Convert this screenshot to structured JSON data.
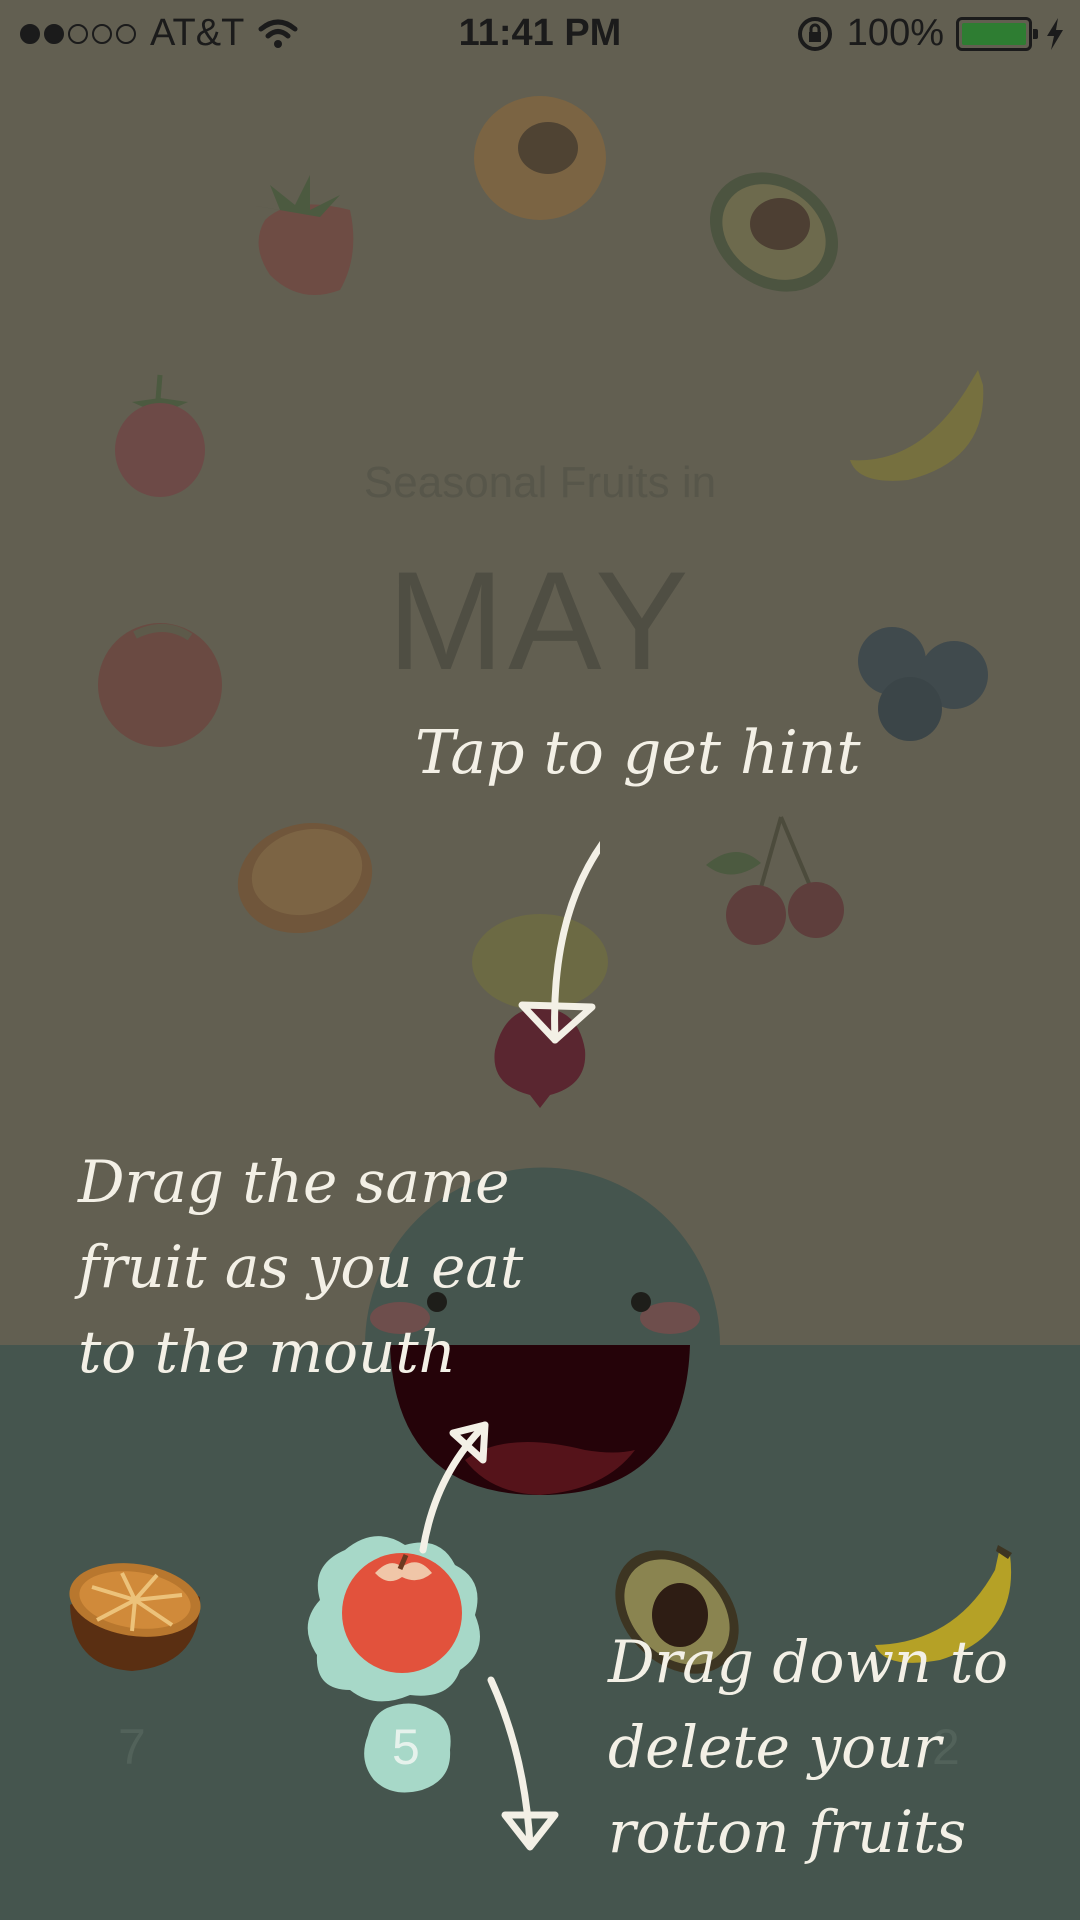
{
  "status_bar": {
    "carrier": "AT&T",
    "time": "11:41 PM",
    "battery": "100%",
    "signal_dots_filled": 2,
    "signal_dots_total": 5
  },
  "header": {
    "subtitle": "Seasonal Fruits in",
    "month": "MAY"
  },
  "hints": {
    "tap": "Tap to get hint",
    "drag_to_mouth": [
      "Drag the same",
      "fruit as you eat",
      "to the mouth"
    ],
    "drag_down": [
      "Drag down to",
      "delete your",
      "rotton fruits"
    ]
  },
  "tray": {
    "items": [
      {
        "fruit": "orange",
        "count": "7"
      },
      {
        "fruit": "apple",
        "count": "5",
        "selected": true
      },
      {
        "fruit": "avocado",
        "count": ""
      },
      {
        "fruit": "banana",
        "count": "2"
      }
    ]
  },
  "colors": {
    "overlay": "#625f51",
    "tray_bg": "#45554e",
    "highlight": "#a7d8c8",
    "hint_text": "#f3f0e6"
  }
}
